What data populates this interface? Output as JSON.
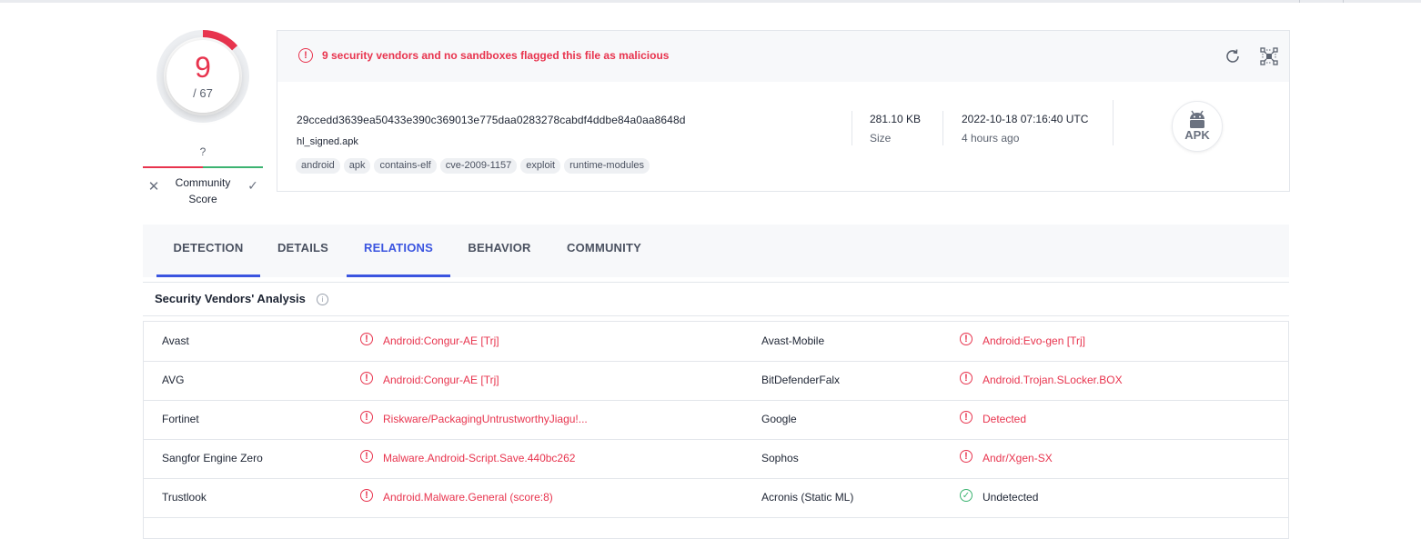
{
  "score": {
    "detections": "9",
    "total": "/ 67",
    "detection_ratio": 0.134
  },
  "community": {
    "question": "?",
    "label_line1": "Community",
    "label_line2": "Score",
    "dismiss_glyph": "✕",
    "approve_glyph": "✓"
  },
  "alert": {
    "text": "9 security vendors and no sandboxes flagged this file as malicious",
    "icon": "alert-circle-icon"
  },
  "file": {
    "hash": "29ccedd3639ea50433e390c369013e775daa0283278cabdf4ddbe84a0aa8648d",
    "name": "hl_signed.apk",
    "tags": [
      "android",
      "apk",
      "contains-elf",
      "cve-2009-1157",
      "exploit",
      "runtime-modules"
    ],
    "size_value": "281.10 KB",
    "size_label": "Size",
    "date_value": "2022-10-18 07:16:40 UTC",
    "date_relative": "4 hours ago",
    "type_badge": "APK"
  },
  "tabs": [
    {
      "label": "DETECTION",
      "active": false
    },
    {
      "label": "DETAILS",
      "active": false
    },
    {
      "label": "RELATIONS",
      "active": true
    },
    {
      "label": "BEHAVIOR",
      "active": false
    },
    {
      "label": "COMMUNITY",
      "active": false
    }
  ],
  "section": {
    "title": "Security Vendors' Analysis"
  },
  "colors": {
    "malicious": "#e8344e",
    "clean": "#3cb371",
    "accent": "#3b55e0"
  },
  "vendors": [
    [
      {
        "name": "Avast",
        "result": "Android:Congur-AE [Trj]",
        "status": "malicious"
      },
      {
        "name": "Avast-Mobile",
        "result": "Android:Evo-gen [Trj]",
        "status": "malicious"
      }
    ],
    [
      {
        "name": "AVG",
        "result": "Android:Congur-AE [Trj]",
        "status": "malicious"
      },
      {
        "name": "BitDefenderFalx",
        "result": "Android.Trojan.SLocker.BOX",
        "status": "malicious"
      }
    ],
    [
      {
        "name": "Fortinet",
        "result": "Riskware/PackagingUntrustworthyJiagu!...",
        "status": "malicious"
      },
      {
        "name": "Google",
        "result": "Detected",
        "status": "malicious"
      }
    ],
    [
      {
        "name": "Sangfor Engine Zero",
        "result": "Malware.Android-Script.Save.440bc262",
        "status": "malicious"
      },
      {
        "name": "Sophos",
        "result": "Andr/Xgen-SX",
        "status": "malicious"
      }
    ],
    [
      {
        "name": "Trustlook",
        "result": "Android.Malware.General (score:8)",
        "status": "malicious"
      },
      {
        "name": "Acronis (Static ML)",
        "result": "Undetected",
        "status": "clean"
      }
    ]
  ]
}
